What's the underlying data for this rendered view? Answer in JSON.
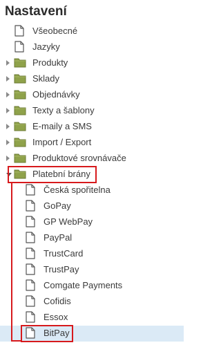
{
  "panel": {
    "title": "Nastavení"
  },
  "tree": {
    "top_items": [
      {
        "label": "Všeobecné",
        "type": "page"
      },
      {
        "label": "Jazyky",
        "type": "page"
      },
      {
        "label": "Produkty",
        "type": "folder",
        "expanded": false
      },
      {
        "label": "Sklady",
        "type": "folder",
        "expanded": false
      },
      {
        "label": "Objednávky",
        "type": "folder",
        "expanded": false
      },
      {
        "label": "Texty a šablony",
        "type": "folder",
        "expanded": false
      },
      {
        "label": "E-maily a SMS",
        "type": "folder",
        "expanded": false
      },
      {
        "label": "Import / Export",
        "type": "folder",
        "expanded": false
      },
      {
        "label": "Produktové srovnávače",
        "type": "folder",
        "expanded": false
      },
      {
        "label": "Platební brány",
        "type": "folder",
        "expanded": true
      }
    ],
    "payment_children": [
      {
        "label": "Česká spořitelna"
      },
      {
        "label": "GoPay"
      },
      {
        "label": "GP WebPay"
      },
      {
        "label": "PayPal"
      },
      {
        "label": "TrustCard"
      },
      {
        "label": "TrustPay"
      },
      {
        "label": "Comgate Payments"
      },
      {
        "label": "Cofidis"
      },
      {
        "label": "Essox"
      },
      {
        "label": "BitPay",
        "selected": true
      }
    ]
  },
  "colors": {
    "folder": "#8fa24a",
    "highlight_outline": "#d7191c",
    "selected_row": "#dbeaf6"
  },
  "icons": {
    "page": "page-icon",
    "folder": "folder-icon",
    "collapsed": "triangle-right-icon",
    "expanded": "triangle-down-icon"
  }
}
